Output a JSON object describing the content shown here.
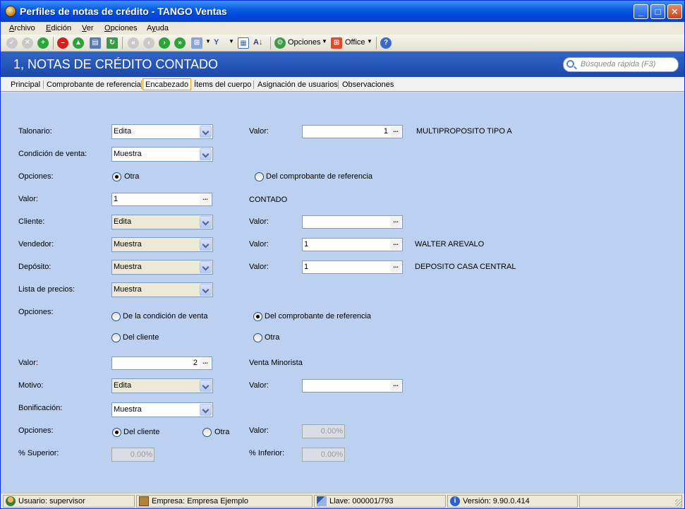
{
  "window": {
    "title": "Perfiles de notas de crédito - TANGO Ventas"
  },
  "menu": {
    "items": [
      {
        "pre": "",
        "u": "A",
        "post": "rchivo"
      },
      {
        "pre": "",
        "u": "E",
        "post": "dición"
      },
      {
        "pre": "",
        "u": "V",
        "post": "er"
      },
      {
        "pre": "",
        "u": "O",
        "post": "pciones"
      },
      {
        "pre": "A",
        "u": "y",
        "post": "uda"
      }
    ]
  },
  "toolbar": {
    "opciones_label": "Opciones",
    "office_label": "Office"
  },
  "header": {
    "title": "1, NOTAS DE CRÉDITO CONTADO",
    "search_placeholder": "Búsqueda rápida (F3)"
  },
  "tabs": [
    "Principal",
    "Comprobante de referencia",
    "Encabezado",
    "Ítems del cuerpo",
    "Asignación de usuarios",
    "Observaciones"
  ],
  "form": {
    "talonario_label": "Talonario:",
    "talonario_value": "Edita",
    "talonario_valor_label": "Valor:",
    "talonario_valor": "1",
    "talonario_desc": "MULTIPROPOSITO TIPO A",
    "condicion_label": "Condición de venta:",
    "condicion_value": "Muestra",
    "opciones1_label": "Opciones:",
    "opciones1_a": "Otra",
    "opciones1_b": "Del comprobante de referencia",
    "valor1_label": "Valor:",
    "valor1": "1",
    "valor1_desc": "CONTADO",
    "cliente_label": "Cliente:",
    "cliente_value": "Edita",
    "cliente_valor_label": "Valor:",
    "cliente_valor": "",
    "vendedor_label": "Vendedor:",
    "vendedor_value": "Muestra",
    "vendedor_valor_label": "Valor:",
    "vendedor_valor": "1",
    "vendedor_desc": "WALTER AREVALO",
    "deposito_label": "Depósito:",
    "deposito_value": "Muestra",
    "deposito_valor_label": "Valor:",
    "deposito_valor": "1",
    "deposito_desc": "DEPOSITO CASA CENTRAL",
    "lista_label": "Lista de precios:",
    "lista_value": "Muestra",
    "opciones2_label": "Opciones:",
    "opciones2_a": "De la condición de venta",
    "opciones2_b": "Del comprobante de referencia",
    "opciones2_c": "Del cliente",
    "opciones2_d": "Otra",
    "valor2_label": "Valor:",
    "valor2": "2",
    "valor2_desc": "Venta Minorista",
    "motivo_label": "Motivo:",
    "motivo_value": "Edita",
    "motivo_valor_label": "Valor:",
    "motivo_valor": "",
    "bonificacion_label": "Bonificación:",
    "bonificacion_value": "Muestra",
    "opciones3_label": "Opciones:",
    "opciones3_a": "Del cliente",
    "opciones3_b": "Otra",
    "opciones3_valor_label": "Valor:",
    "opciones3_valor": "0.00%",
    "superior_label": "% Superior:",
    "superior_value": "0.00%",
    "inferior_label": "% Inferior:",
    "inferior_value": "0.00%"
  },
  "status": {
    "usuario": "Usuario: supervisor",
    "empresa": "Empresa: Empresa Ejemplo",
    "llave": "Llave: 000001/793",
    "version": "Versión: 9.90.0.414"
  },
  "colors": {
    "title_bar": "#0a5ddf",
    "header": "#2a5abb",
    "content": "#bcd0f0",
    "accent": "#e5a600"
  }
}
